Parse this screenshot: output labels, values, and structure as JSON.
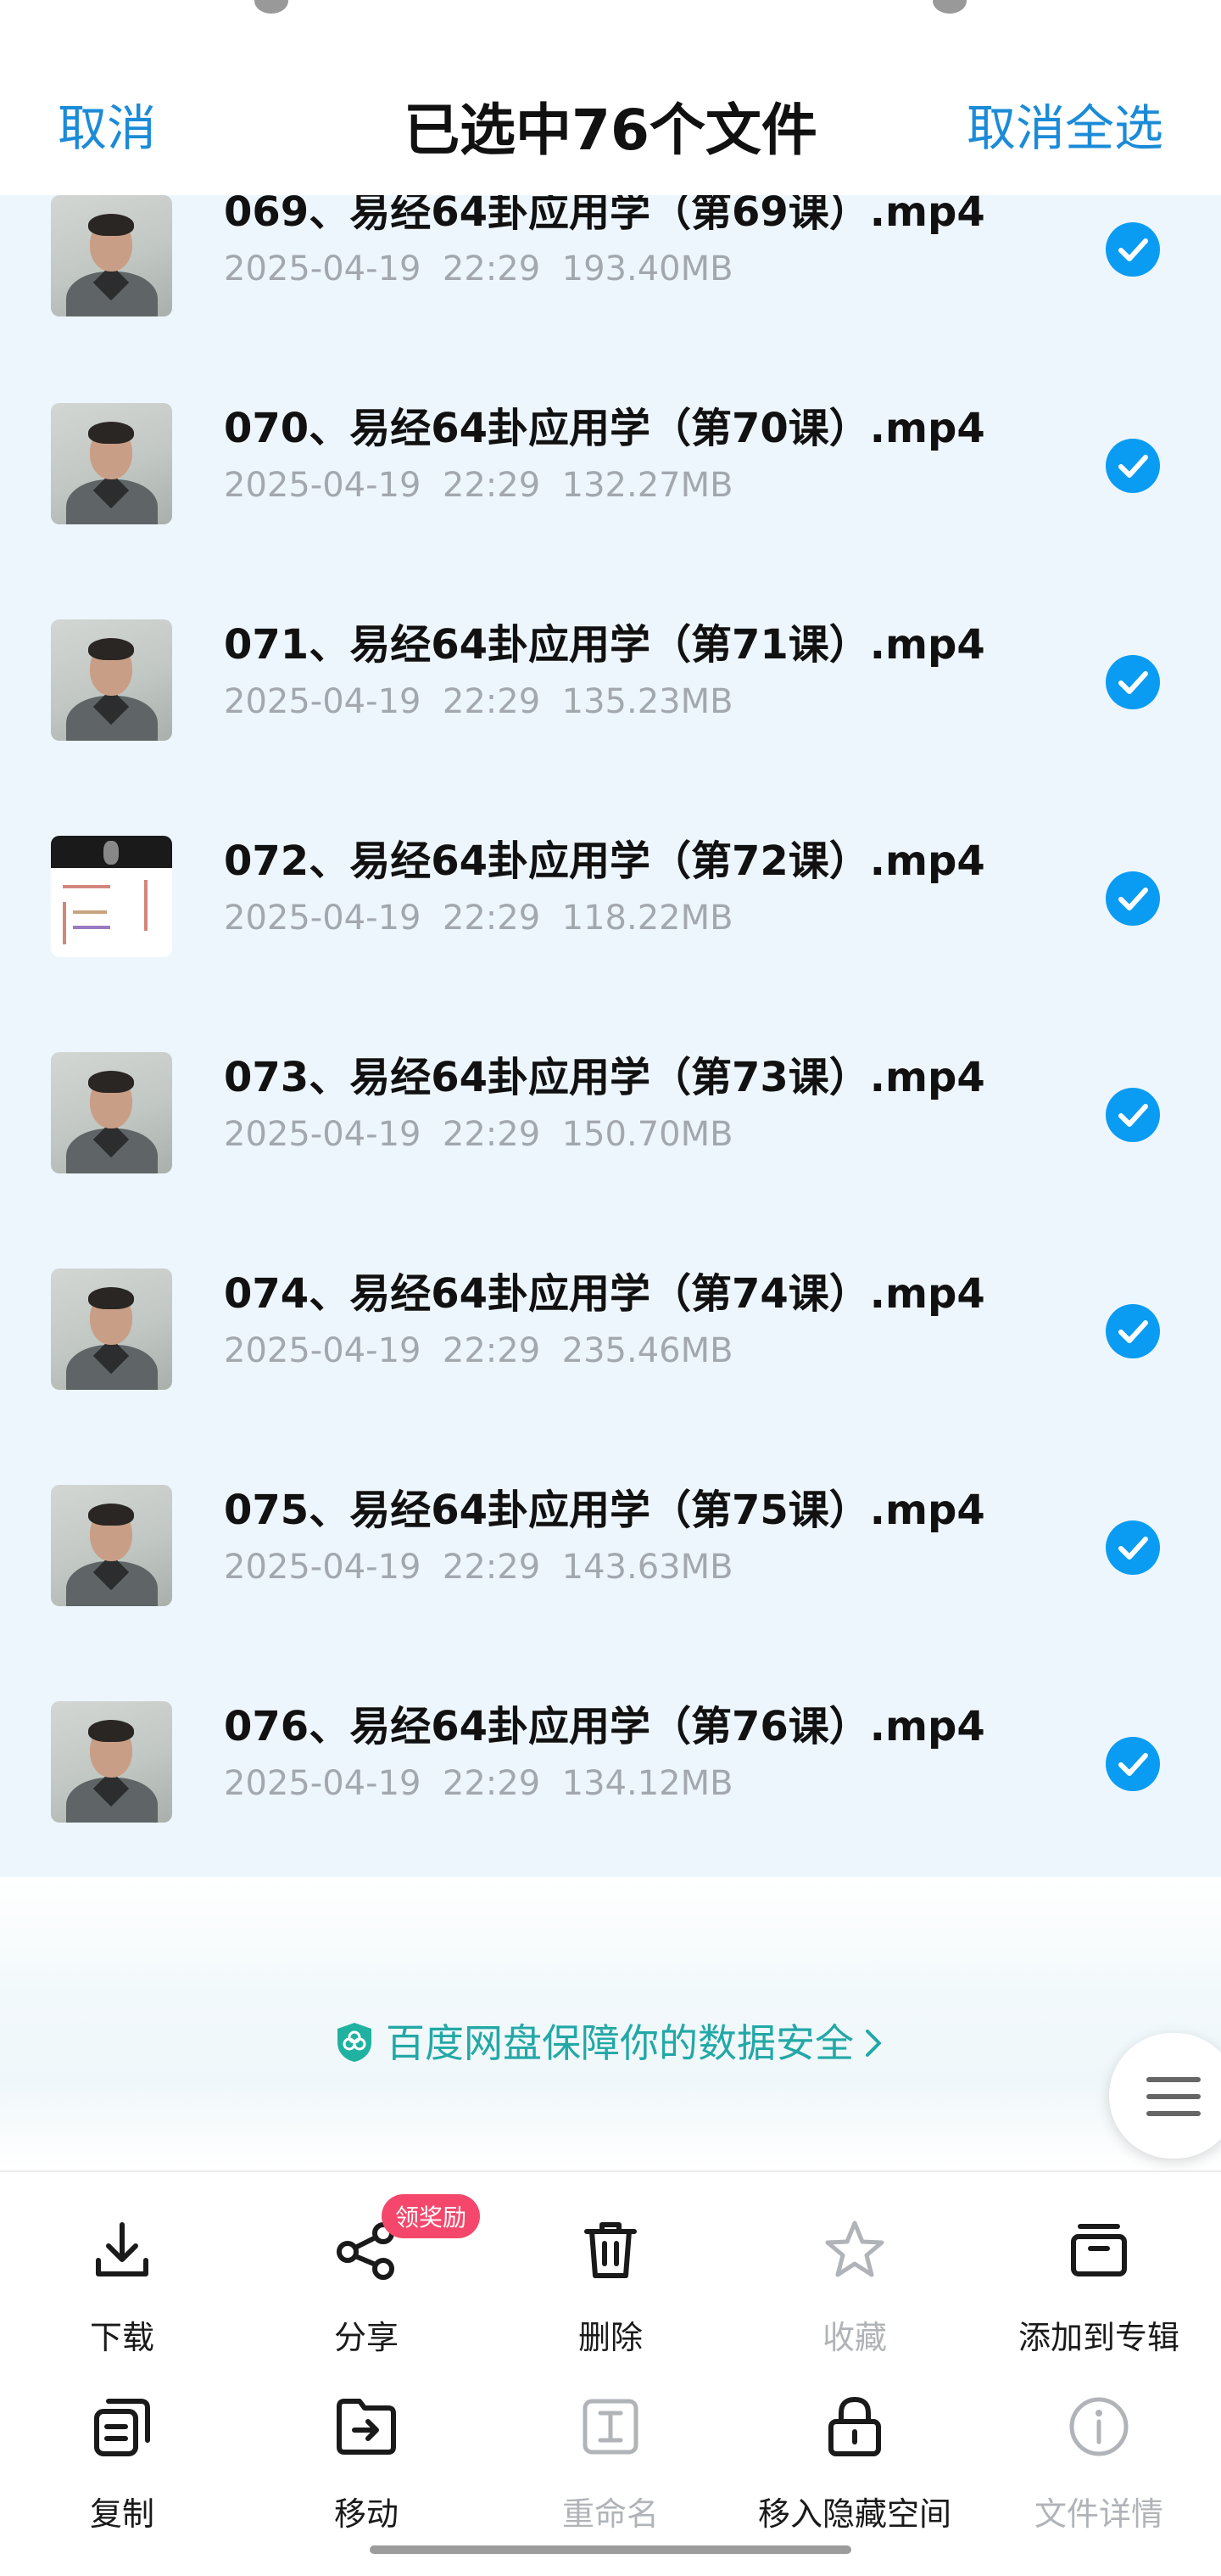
{
  "header": {
    "cancel_label": "取消",
    "title": "已选中76个文件",
    "cancel_all_label": "取消全选"
  },
  "files": [
    {
      "name": "069、易经64卦应用学（第69课）.mp4",
      "date": "2025-04-19",
      "time": "22:29",
      "size": "193.40MB",
      "selected": true
    },
    {
      "name": "070、易经64卦应用学（第70课）.mp4",
      "date": "2025-04-19",
      "time": "22:29",
      "size": "132.27MB",
      "selected": true
    },
    {
      "name": "071、易经64卦应用学（第71课）.mp4",
      "date": "2025-04-19",
      "time": "22:29",
      "size": "135.23MB",
      "selected": true
    },
    {
      "name": "072、易经64卦应用学（第72课）.mp4",
      "date": "2025-04-19",
      "time": "22:29",
      "size": "118.22MB",
      "selected": true
    },
    {
      "name": "073、易经64卦应用学（第73课）.mp4",
      "date": "2025-04-19",
      "time": "22:29",
      "size": "150.70MB",
      "selected": true
    },
    {
      "name": "074、易经64卦应用学（第74课）.mp4",
      "date": "2025-04-19",
      "time": "22:29",
      "size": "235.46MB",
      "selected": true
    },
    {
      "name": "075、易经64卦应用学（第75课）.mp4",
      "date": "2025-04-19",
      "time": "22:29",
      "size": "143.63MB",
      "selected": true
    },
    {
      "name": "076、易经64卦应用学（第76课）.mp4",
      "date": "2025-04-19",
      "time": "22:29",
      "size": "134.12MB",
      "selected": true
    }
  ],
  "security_banner": {
    "text": "百度网盘保障你的数据安全",
    "icon": "shield-icon",
    "color": "#22a8a6"
  },
  "toolbar": {
    "row1": [
      {
        "label": "下载",
        "icon": "download-icon",
        "enabled": true
      },
      {
        "label": "分享",
        "icon": "share-icon",
        "enabled": true,
        "badge": "领奖励"
      },
      {
        "label": "删除",
        "icon": "trash-icon",
        "enabled": true
      },
      {
        "label": "收藏",
        "icon": "star-icon",
        "enabled": false
      },
      {
        "label": "添加到专辑",
        "icon": "album-icon",
        "enabled": true
      }
    ],
    "row2": [
      {
        "label": "复制",
        "icon": "copy-icon",
        "enabled": true
      },
      {
        "label": "移动",
        "icon": "move-folder-icon",
        "enabled": true
      },
      {
        "label": "重命名",
        "icon": "rename-icon",
        "enabled": false
      },
      {
        "label": "移入隐藏空间",
        "icon": "lock-icon",
        "enabled": true
      },
      {
        "label": "文件详情",
        "icon": "info-icon",
        "enabled": false
      }
    ]
  },
  "colors": {
    "accent": "#1b8bd8",
    "check": "#0a9cf2",
    "list_background": "#eef6fd",
    "badge": "#f4476b"
  }
}
